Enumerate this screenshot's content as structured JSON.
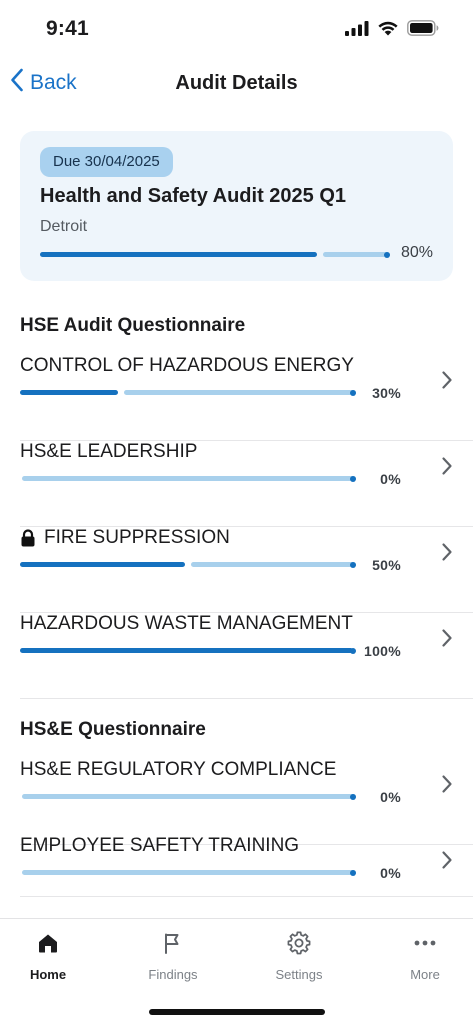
{
  "status_bar": {
    "time": "9:41"
  },
  "nav": {
    "back_label": "Back",
    "title": "Audit Details"
  },
  "audit": {
    "due_badge": "Due 30/04/2025",
    "title": "Health and Safety Audit 2025 Q1",
    "location": "Detroit",
    "progress": 0.8,
    "progress_label": "80%"
  },
  "sections": [
    {
      "title": "HSE Audit Questionnaire",
      "items": [
        {
          "label": "CONTROL OF HAZARDOUS ENERGY",
          "progress": 0.3,
          "percent": "30%",
          "locked": false
        },
        {
          "label": "HS&E LEADERSHIP",
          "progress": 0.0,
          "percent": "0%",
          "locked": false
        },
        {
          "label": "FIRE SUPPRESSION",
          "progress": 0.5,
          "percent": "50%",
          "locked": true
        },
        {
          "label": "HAZARDOUS WASTE MANAGEMENT",
          "progress": 1.0,
          "percent": "100%",
          "locked": false
        }
      ]
    },
    {
      "title": "HS&E Questionnaire",
      "items": [
        {
          "label": "HS&E REGULATORY COMPLIANCE",
          "progress": 0.0,
          "percent": "0%",
          "locked": false
        },
        {
          "label": "EMPLOYEE SAFETY TRAINING",
          "progress": 0.0,
          "percent": "0%",
          "locked": false
        }
      ]
    }
  ],
  "tabs": [
    {
      "label": "Home",
      "icon": "home-icon",
      "active": true
    },
    {
      "label": "Findings",
      "icon": "flag-icon",
      "active": false
    },
    {
      "label": "Settings",
      "icon": "gear-icon",
      "active": false
    },
    {
      "label": "More",
      "icon": "more-icon",
      "active": false
    }
  ],
  "colors": {
    "accent": "#1a73c8",
    "progress_fill": "#1571bf",
    "progress_track": "#a8d0ec",
    "card_bg": "#eef5fb",
    "badge_bg": "#a9d1ef"
  }
}
